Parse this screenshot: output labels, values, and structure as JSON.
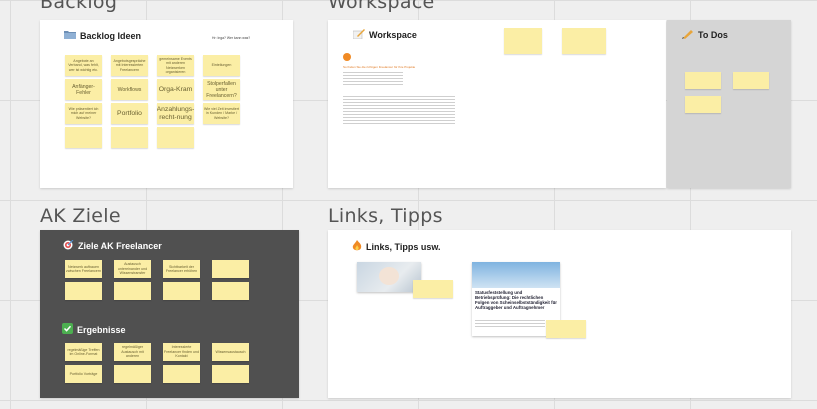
{
  "frames": {
    "backlog": {
      "title": "Backlog"
    },
    "workspace": {
      "title": "Workspace"
    },
    "ak_ziele": {
      "title": "AK Ziele"
    },
    "links": {
      "title": "Links, Tipps"
    }
  },
  "backlog_board": {
    "heading": "Backlog Ideen",
    "note": "Hr: Inga? Wer kann was?",
    "stickies": [
      "Angebote an Verband, was fehlt, wer ist wichtig etc.",
      "Angebotsgespräche mit Interessierten Freelancern",
      "gemeinsame Events mit anderen Netzwerken organisieren",
      "Einteilungen",
      "Anfänger-Fehler",
      "Workflows",
      "Orga-Kram",
      "Stolperfallen unter Freelancern?",
      "Wie präsentiert ich mich auf meiner Website?",
      "Portfolio",
      "Anzahlungs-recht-nung",
      "Wie viel Zeit investiert in Kunden / Marke / Website?",
      "",
      "",
      ""
    ]
  },
  "workspace_board": {
    "heading": "Workspace",
    "doc_title": "So finden Sie die richtigen Freelancer für Ihre Projekte"
  },
  "todos_board": {
    "heading": "To Dos"
  },
  "ziele_board": {
    "heading": "Ziele AK Freelancer",
    "goal_stickies": [
      "Netzwerk aufbauen zwischen Freelancern",
      "Austausch untereinander und Wissenstransfer",
      "Sichtbarkeit der Freelancer erhöhen",
      "",
      "",
      "",
      "",
      ""
    ],
    "results_heading": "Ergebnisse",
    "result_stickies": [
      "regelmäßige Treffen im Online-Format",
      "regelmäßiger Austausch mit anderen",
      "Interessierte Freelancer finden und Kontakt",
      "Wissensaustausch",
      "Portfolio Vorträge",
      "",
      "",
      ""
    ]
  },
  "links_board": {
    "heading": "Links, Tipps usw.",
    "article_title": "Statusfeststellung und Betriebsprüfung: Die rechtlichen Folgen von Scheinselbstständigkeit für Auftraggeber und Auftragnehmer"
  },
  "colors": {
    "sticky": "#fbeea5",
    "dark_frame": "#505050",
    "todo_panel": "#d5d5d5"
  }
}
